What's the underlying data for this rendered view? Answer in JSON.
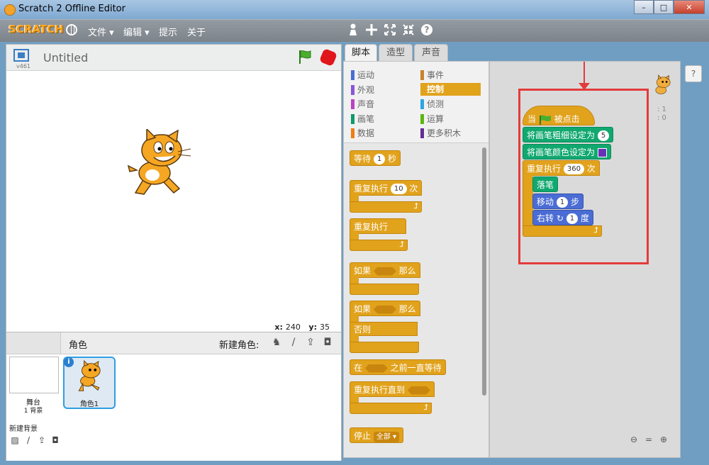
{
  "window": {
    "title": "Scratch 2 Offline Editor",
    "minimize": "–",
    "maximize": "□",
    "close": "✕"
  },
  "menubar": {
    "logo": "SCRATCH",
    "items": {
      "file": "文件 ▾",
      "edit": "编辑 ▾",
      "tips": "提示",
      "about": "关于"
    },
    "tools": [
      "duplicate-icon",
      "delete-icon",
      "grow-icon",
      "shrink-icon",
      "help-icon"
    ]
  },
  "stage": {
    "version": "v461",
    "project_title": "Untitled",
    "mouse_x_label": "x:",
    "mouse_x": "240",
    "mouse_y_label": "y:",
    "mouse_y": "35"
  },
  "sprites": {
    "header_label": "角色",
    "new_sprite_label": "新建角色:",
    "stage_name": "舞台",
    "backdrop_count": "1 背景",
    "new_backdrop_label": "新建背景",
    "sprite1_name": "角色1"
  },
  "tabs": {
    "scripts": "脚本",
    "costumes": "造型",
    "sounds": "声音"
  },
  "categories": {
    "motion": "运动",
    "looks": "外观",
    "sound": "声音",
    "pen": "画笔",
    "data": "数据",
    "events": "事件",
    "control": "控制",
    "sensing": "侦测",
    "operators": "运算",
    "more": "更多积木"
  },
  "category_colors": {
    "motion": "#4a6cd4",
    "looks": "#8a55d7",
    "sound": "#bb42c3",
    "pen": "#0e9a6c",
    "data": "#ee7d16",
    "events": "#c88330",
    "control": "#e1a21c",
    "sensing": "#2ca5e2",
    "operators": "#5cb712",
    "more": "#632d99"
  },
  "palette": {
    "wait": {
      "label": "等待",
      "value": "1",
      "unit": "秒"
    },
    "repeat": {
      "label": "重复执行",
      "value": "10",
      "unit": "次"
    },
    "forever": {
      "label": "重复执行"
    },
    "if_then": {
      "label": "如果",
      "then": "那么"
    },
    "if_else": {
      "label": "如果",
      "then": "那么",
      "else": "否则"
    },
    "wait_until": {
      "label": "在",
      "suffix": "之前一直等待"
    },
    "repeat_until": {
      "label": "重复执行直到"
    },
    "stop": {
      "label": "停止",
      "option": "全部 ▾"
    }
  },
  "script": {
    "hat": {
      "prefix": "当",
      "suffix": "被点击"
    },
    "pen_size": {
      "label": "将画笔粗细设定为",
      "value": "5"
    },
    "pen_color": {
      "label": "将画笔颜色设定为",
      "swatch": "#6a2fb7"
    },
    "repeat": {
      "label": "重复执行",
      "value": "360",
      "unit": "次"
    },
    "pen_down": {
      "label": "落笔"
    },
    "move": {
      "label": "移动",
      "value": "1",
      "unit": "步"
    },
    "turn": {
      "label": "右转",
      "value": "1",
      "unit": "度"
    },
    "sprite_x": ": 1",
    "sprite_y": ": 0"
  },
  "annotation": {
    "color": "#e33b3b"
  }
}
